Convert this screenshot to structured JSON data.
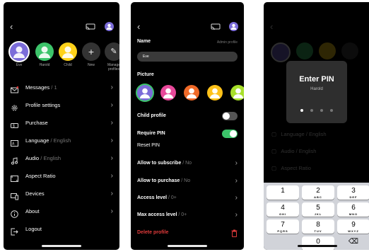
{
  "screen1": {
    "profiles": [
      {
        "name": "Eve",
        "color": "#7b6cd9",
        "ring": "#ffffff"
      },
      {
        "name": "Harold",
        "color": "#3cc46a"
      },
      {
        "name": "Child",
        "color": "#ffd21a"
      },
      {
        "name": "New",
        "icon": "plus-icon"
      },
      {
        "name": "Manage profiles",
        "icon": "pencil-icon"
      }
    ],
    "menu": [
      {
        "label": "Messages",
        "sub": "/ 1",
        "icon": "mail-icon"
      },
      {
        "label": "Profile settings",
        "sub": "",
        "icon": "gear-icon"
      },
      {
        "label": "Purchase",
        "sub": "",
        "icon": "ticket-icon"
      },
      {
        "label": "Language",
        "sub": "/ English",
        "icon": "language-icon"
      },
      {
        "label": "Audio",
        "sub": "/ English",
        "icon": "music-note-icon"
      },
      {
        "label": "Aspect Ratio",
        "sub": "",
        "icon": "aspect-ratio-icon"
      },
      {
        "label": "Devices",
        "sub": "",
        "icon": "devices-icon"
      },
      {
        "label": "About",
        "sub": "",
        "icon": "info-icon"
      },
      {
        "label": "Logout",
        "sub": "",
        "icon": "logout-icon"
      }
    ]
  },
  "screen2": {
    "name_label": "Name",
    "name_hint": "Admin profile",
    "name_value": "Eve",
    "picture_label": "Picture",
    "picture_colors": [
      "#7b6cd9",
      "#e8489a",
      "#f06a28",
      "#ffc21a",
      "#a8e02a"
    ],
    "child_profile_label": "Child profile",
    "child_profile_on": false,
    "require_pin_label": "Require PIN",
    "require_pin_on": true,
    "reset_pin_label": "Reset PIN",
    "rows": [
      {
        "label": "Allow to subscribe",
        "sub": "/ No"
      },
      {
        "label": "Allow to purchase",
        "sub": "/ No"
      },
      {
        "label": "Access level",
        "sub": "/ 0+"
      },
      {
        "label": "Max access level",
        "sub": "/ 0+"
      }
    ],
    "delete_label": "Delete profile",
    "accent": "#3cc46a",
    "danger": "#e23b3b"
  },
  "screen3": {
    "title": "Enter PIN",
    "subtitle": "Harold",
    "pin_entered": 1,
    "pin_length": 4,
    "keys": [
      {
        "n": "1",
        "l": ""
      },
      {
        "n": "2",
        "l": "ABC"
      },
      {
        "n": "3",
        "l": "DEF"
      },
      {
        "n": "4",
        "l": "GHI"
      },
      {
        "n": "5",
        "l": "JKL"
      },
      {
        "n": "6",
        "l": "MNO"
      },
      {
        "n": "7",
        "l": "PQRS"
      },
      {
        "n": "8",
        "l": "TUV"
      },
      {
        "n": "9",
        "l": "WXYZ"
      },
      {
        "n": "",
        "l": ""
      },
      {
        "n": "0",
        "l": ""
      },
      {
        "n": "⌫",
        "l": ""
      }
    ]
  }
}
